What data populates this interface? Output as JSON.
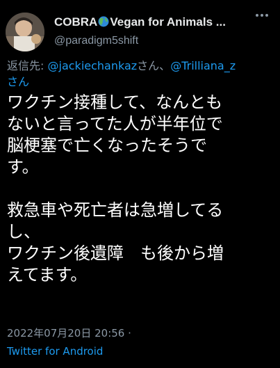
{
  "author": {
    "name_prefix": "COBRA",
    "name_suffix": "Vegan for Animals ...",
    "globe_icon": "globe-americas-icon",
    "handle": "@paradigm5shift"
  },
  "reply": {
    "label": "返信先:",
    "mention1": "@jackiechankaz",
    "sep": "さん、",
    "mention2": "@Trilliana_z",
    "suffix": "さん"
  },
  "tweet": {
    "line1": "ワクチン接種して、なんとも",
    "line2": "ないと言ってた人が半年位で",
    "line3": "脳梗塞で亡くなったそうで",
    "line4": "す。",
    "line5": "救急車や死亡者は急増してる",
    "line6": "し、",
    "line7": "ワクチン後遺障　も後から増",
    "line8": "えてます。"
  },
  "meta": {
    "timestamp": "2022年07月20日 20:56 ·",
    "source": "Twitter for Android"
  },
  "colors": {
    "background": "#000000",
    "text": "#ffffff",
    "muted": "#8b98a5",
    "link": "#1d9bf0"
  }
}
